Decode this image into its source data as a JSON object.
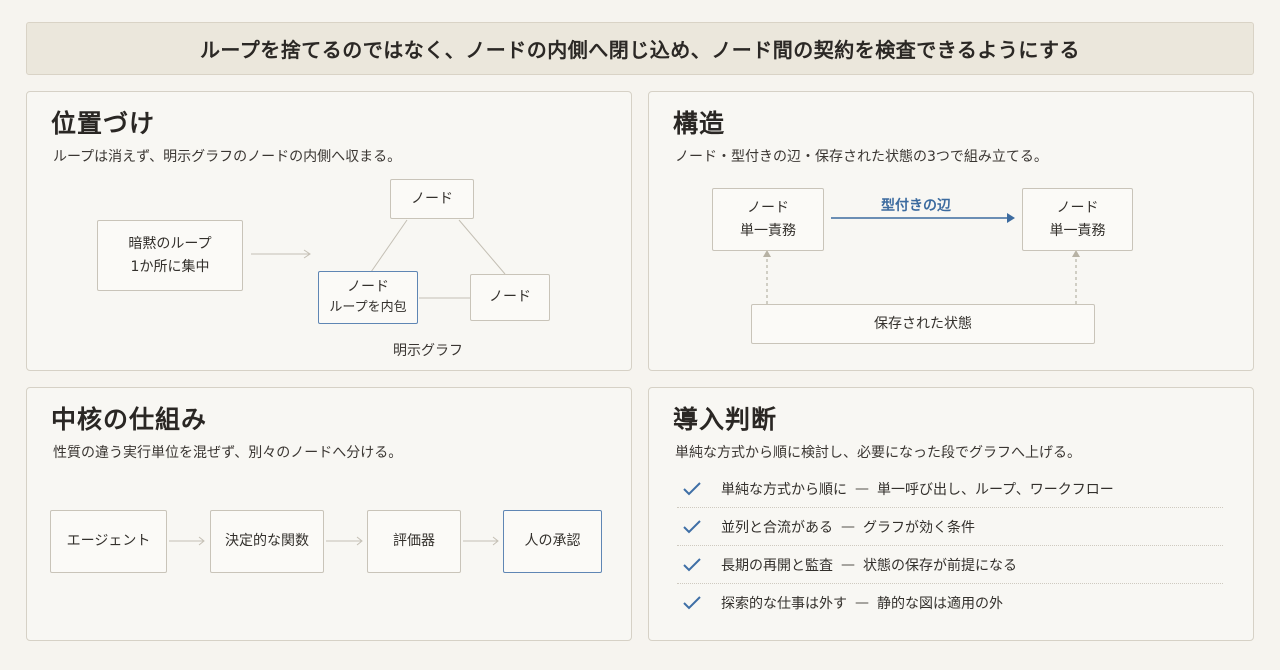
{
  "banner": "ループを捨てるのではなく、ノードの内側へ閉じ込め、ノード間の契約を検査できるようにする",
  "positioning": {
    "title": "位置づけ",
    "subtitle": "ループは消えず、明示グラフのノードの内側へ収まる。",
    "implicit_loop": [
      "暗黙のループ",
      "1か所に集中"
    ],
    "node_top": "ノード",
    "node_loop": [
      "ノード",
      "ループを内包"
    ],
    "node_right": "ノード",
    "graph_label": "明示グラフ",
    "colors": {
      "accent": "#5f86b4"
    }
  },
  "structure": {
    "title": "構造",
    "subtitle": "ノード・型付きの辺・保存された状態の3つで組み立てる。",
    "node_left": [
      "ノード",
      "単一責務"
    ],
    "node_right": [
      "ノード",
      "単一責務"
    ],
    "edge_label": "型付きの辺",
    "state_label": "保存された状態",
    "colors": {
      "edge": "#3c6b9f"
    }
  },
  "core": {
    "title": "中核の仕組み",
    "subtitle": "性質の違う実行単位を混ぜず、別々のノードへ分ける。",
    "steps": [
      "エージェント",
      "決定的な関数",
      "評価器",
      "人の承認"
    ]
  },
  "adoption": {
    "title": "導入判断",
    "subtitle": "単純な方式から順に検討し、必要になった段でグラフへ上げる。",
    "items": [
      {
        "head": "単純な方式から順に",
        "sep": "—",
        "tail": "単一呼び出し、ループ、ワークフロー"
      },
      {
        "head": "並列と合流がある",
        "sep": "—",
        "tail": "グラフが効く条件"
      },
      {
        "head": "長期の再開と監査",
        "sep": "—",
        "tail": "状態の保存が前提になる"
      },
      {
        "head": "探索的な仕事は外す",
        "sep": "—",
        "tail": "静的な図は適用の外"
      }
    ],
    "icon": "check-icon",
    "colors": {
      "check": "#3f6fa6"
    }
  }
}
